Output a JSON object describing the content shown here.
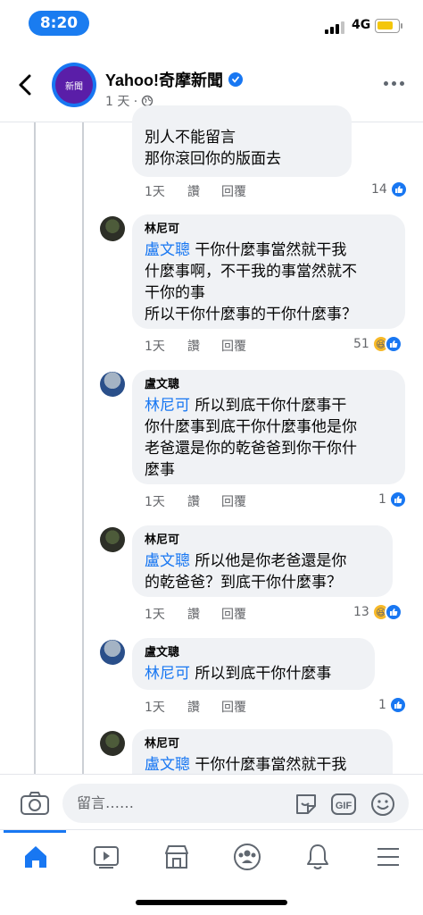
{
  "status": {
    "time": "8:20",
    "network": "4G",
    "battery_level": 0.8
  },
  "header": {
    "page_name": "Yahoo!奇摩新聞",
    "avatar_text": "新聞",
    "post_time": "1 天 ·"
  },
  "comments": [
    {
      "author": "",
      "mention": "",
      "text": "別人不能留言\n那你滾回你的版面去",
      "time": "1天",
      "reply": "讚",
      "reply2": "回覆",
      "likes": "14"
    },
    {
      "author": "林尼可",
      "mention": "盧文聰",
      "text": " 干你什麼事當然就干我\n什麼事啊，不干我的事當然就不\n干你的事\n所以干你什麼事的干你什麼事？",
      "time": "1天",
      "reply": "讚",
      "reply2": "回覆",
      "likes": "51"
    },
    {
      "author": "盧文聰",
      "mention": "林尼可",
      "text": " 所以到底干你什麼事干\n你什麼事到底干你什麼事他是你\n老爸還是你的乾爸爸到你干你什\n麼事",
      "time": "1天",
      "reply": "讚",
      "reply2": "回覆",
      "likes": "1"
    },
    {
      "author": "林尼可",
      "mention": "盧文聰",
      "text": " 所以他是你老爸還是你\n的乾爸爸？到底干你什麼事？",
      "time": "1天",
      "reply": "讚",
      "reply2": "回覆",
      "likes": "13"
    },
    {
      "author": "盧文聰",
      "mention": "林尼可",
      "text": " 所以到底干你什麼事",
      "time": "1天",
      "reply": "讚",
      "reply2": "回覆",
      "likes": "1"
    },
    {
      "author": "林尼可",
      "mention": "盧文聰",
      "text": " 干你什麼事當然就干我",
      "time": "",
      "reply": "",
      "reply2": "",
      "likes": ""
    }
  ],
  "composer": {
    "placeholder": "留言……",
    "gif_label": "GIF"
  },
  "tabs": [
    "home",
    "watch",
    "marketplace",
    "groups",
    "notifications",
    "menu"
  ],
  "colors": {
    "accent": "#1877f2",
    "bubble": "#f0f2f5",
    "muted": "#65676b"
  }
}
